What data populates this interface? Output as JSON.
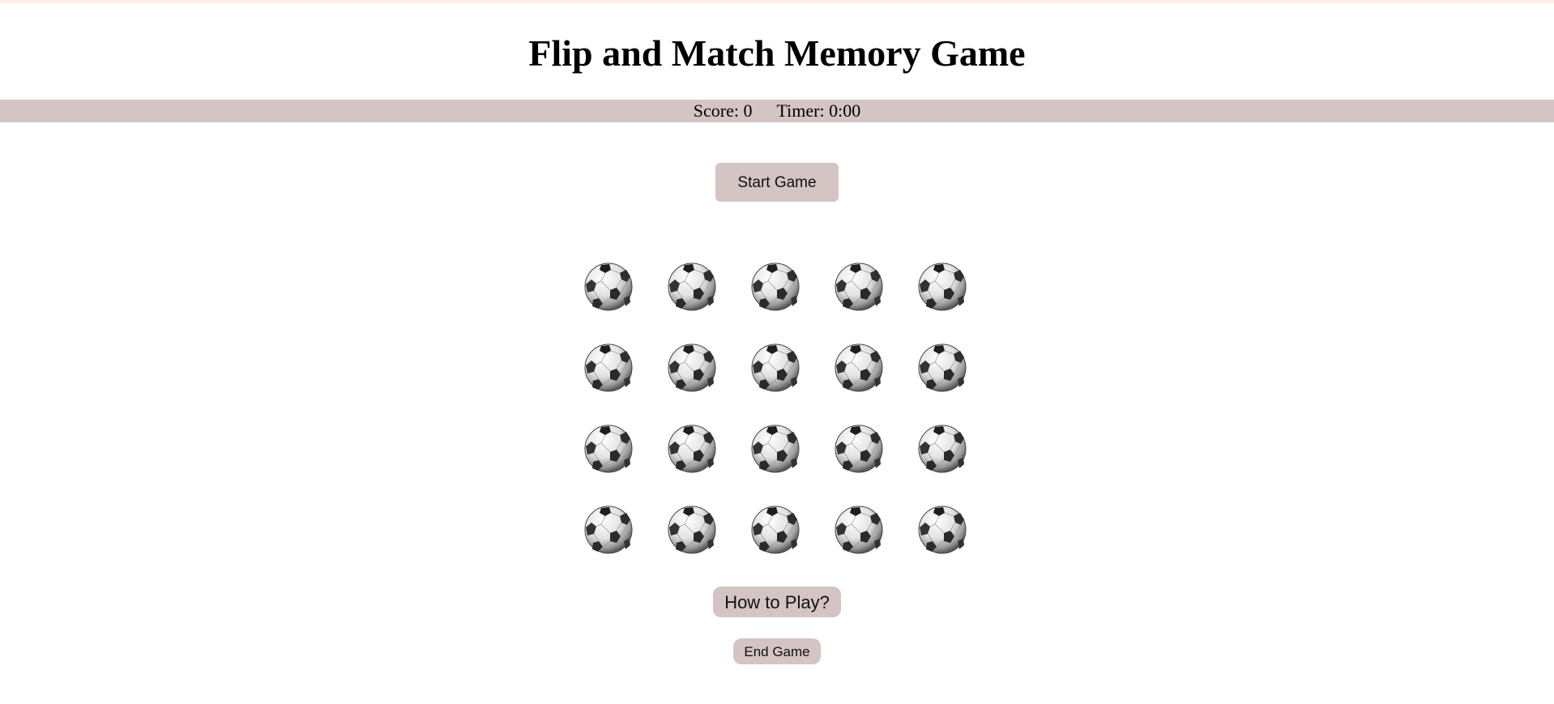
{
  "title": "Flip and Match Memory Game",
  "status": {
    "score_label": "Score: 0",
    "timer_label": "Timer: 0:00"
  },
  "buttons": {
    "start": "Start Game",
    "how_to_play": "How to Play?",
    "end": "End Game"
  },
  "board": {
    "rows": 4,
    "columns": 5,
    "card_back_icon": "soccer-ball-icon",
    "cards_face_down": 20
  },
  "colors": {
    "bar_and_buttons": "#d4c4c4"
  }
}
